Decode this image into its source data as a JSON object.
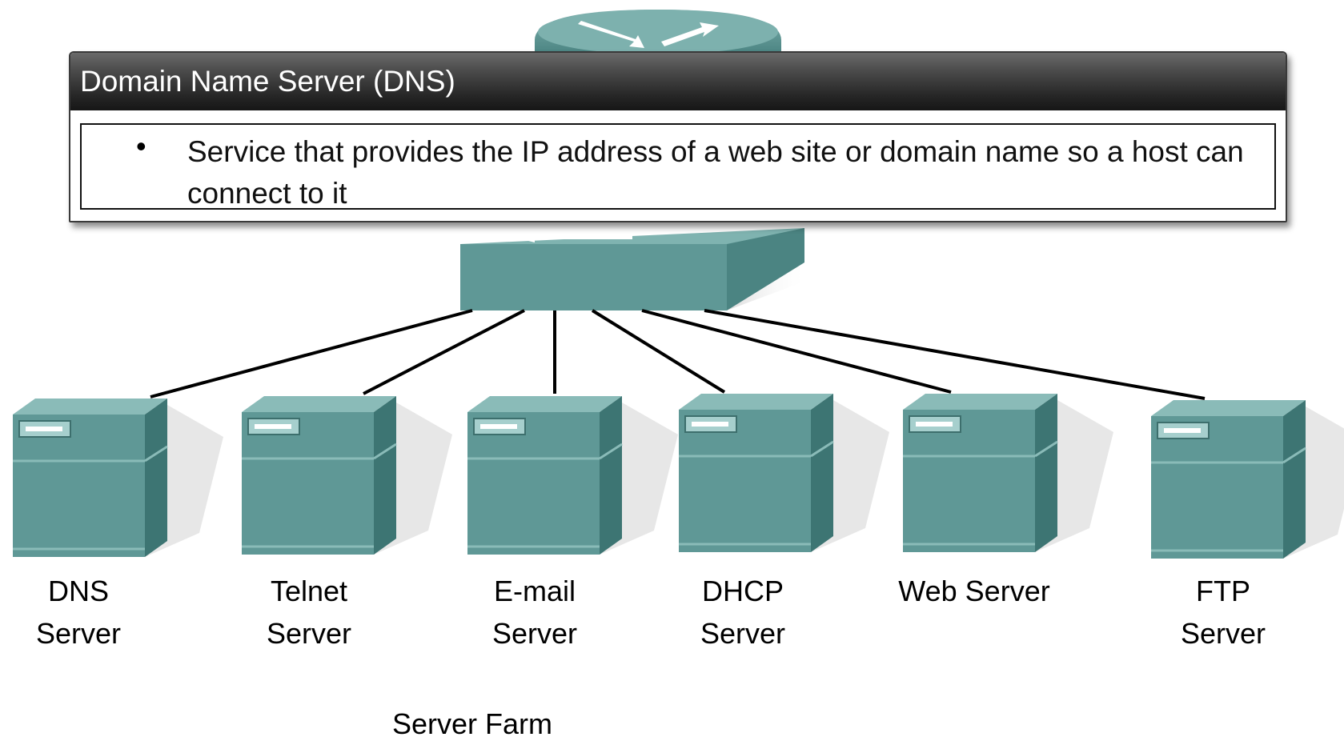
{
  "popup": {
    "title": "Domain Name Server (DNS)",
    "description": "Service that provides the IP address of a web site or domain name so a host can connect to it"
  },
  "servers": [
    {
      "line1": "DNS",
      "line2": "Server"
    },
    {
      "line1": "Telnet",
      "line2": "Server"
    },
    {
      "line1": "E-mail",
      "line2": "Server"
    },
    {
      "line1": "DHCP",
      "line2": "Server"
    },
    {
      "line1": "Web Server",
      "line2": ""
    },
    {
      "line1": "FTP",
      "line2": "Server"
    }
  ],
  "group_label": "Server Farm",
  "colors": {
    "device": "#5f9896",
    "device_dark": "#3d7573",
    "device_light": "#8abbb8",
    "link": "#000000"
  }
}
